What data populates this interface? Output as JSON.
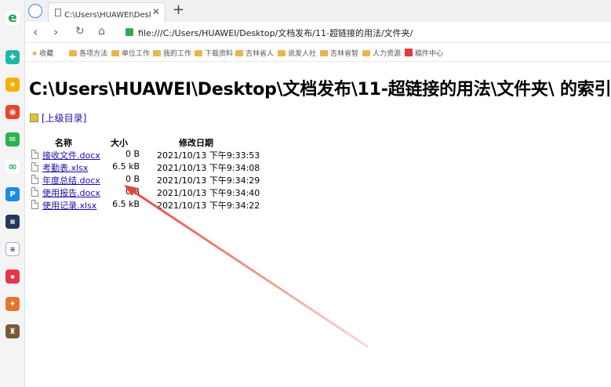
{
  "browser": {
    "tab_title": "C:\\Users\\HUAWEI\\Desktop\\文",
    "tab_close": "✕",
    "new_tab": "+",
    "url": "file:///C:/Users/HUAWEI/Desktop/文档发布/11-超链接的用法/文件夹/"
  },
  "bookmarks": [
    {
      "label": "收藏",
      "icon": "star-icon"
    },
    {
      "label": "各项方法",
      "icon": "folder-icon"
    },
    {
      "label": "单位工作",
      "icon": "folder-icon"
    },
    {
      "label": "我的工作",
      "icon": "folder-icon"
    },
    {
      "label": "下载资料",
      "icon": "folder-icon"
    },
    {
      "label": "吉林省人",
      "icon": "folder-icon"
    },
    {
      "label": "说发人社",
      "icon": "folder-icon"
    },
    {
      "label": "吉林省智",
      "icon": "folder-icon"
    },
    {
      "label": "人力资源",
      "icon": "folder-icon"
    },
    {
      "label": "稿件中心",
      "icon": "red-logo-icon"
    }
  ],
  "page": {
    "heading": "C:\\Users\\HUAWEI\\Desktop\\文档发布\\11-超链接的用法\\文件夹\\ 的索引",
    "parent_link": "[上级目录]",
    "columns": {
      "name": "名称",
      "size": "大小",
      "date": "修改日期"
    },
    "files": [
      {
        "name": "接收文件.docx",
        "size": "0 B",
        "date": "2021/10/13 下午9:33:53"
      },
      {
        "name": "考勤表.xlsx",
        "size": "6.5 kB",
        "date": "2021/10/13 下午9:34:08"
      },
      {
        "name": "年度总结.docx",
        "size": "0 B",
        "date": "2021/10/13 下午9:34:29"
      },
      {
        "name": "使用报告.docx",
        "size": "0 B",
        "date": "2021/10/13 下午9:34:40"
      },
      {
        "name": "使用记录.xlsx",
        "size": "6.5 kB",
        "date": "2021/10/13 下午9:34:22"
      }
    ]
  },
  "colors": {
    "link": "#1a0dab",
    "annotation_arrow": "#e04a3c"
  }
}
